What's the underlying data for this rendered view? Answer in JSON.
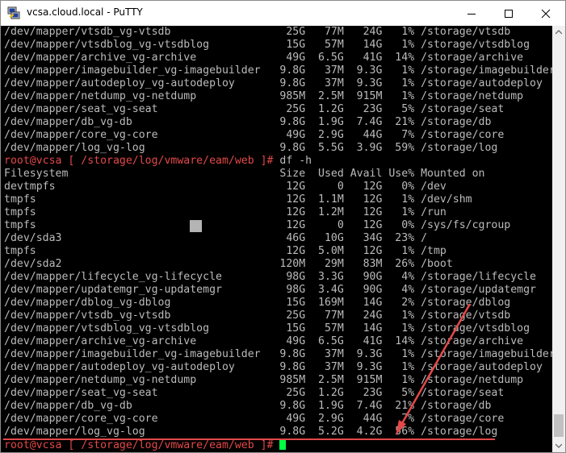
{
  "window": {
    "title": "vcsa.cloud.local - PuTTY",
    "accent_color": "#e44848",
    "cursor_color": "#00ff44"
  },
  "terminal": {
    "lines": [
      "/dev/mapper/vtsdb_vg-vtsdb                  25G   77M   24G   1% /storage/vtsdb",
      "/dev/mapper/vtsdblog_vg-vtsdblog            15G   57M   14G   1% /storage/vtsdblog",
      "/dev/mapper/archive_vg-archive              49G  6.5G   41G  14% /storage/archive",
      "/dev/mapper/imagebuilder_vg-imagebuilder   9.8G   37M  9.3G   1% /storage/imagebuilder",
      "/dev/mapper/autodeploy_vg-autodeploy       9.8G   37M  9.3G   1% /storage/autodeploy",
      "/dev/mapper/netdump_vg-netdump             985M  2.5M  915M   1% /storage/netdump",
      "/dev/mapper/seat_vg-seat                    25G  1.2G   23G   5% /storage/seat",
      "/dev/mapper/db_vg-db                       9.8G  1.9G  7.4G  21% /storage/db",
      "/dev/mapper/core_vg-core                    49G  2.9G   44G   7% /storage/core",
      "/dev/mapper/log_vg-log                     9.8G  5.5G  3.9G  59% /storage/log",
      "",
      "Filesystem                                 Size  Used Avail Use% Mounted on",
      "devtmpfs                                    12G     0   12G   0% /dev",
      "tmpfs                                       12G  1.1M   12G   1% /dev/shm",
      "tmpfs                                       12G  1.2M   12G   1% /run",
      "tmpfs                                       12G     0   12G   0% /sys/fs/cgroup",
      "/dev/sda3                                   46G   10G   34G  23% /",
      "tmpfs                                       12G  5.0M   12G   1% /tmp",
      "/dev/sda2                                  120M   29M   83M  26% /boot",
      "/dev/mapper/lifecycle_vg-lifecycle          98G  3.3G   90G   4% /storage/lifecycle",
      "/dev/mapper/updatemgr_vg-updatemgr          98G  3.4G   90G   4% /storage/updatemgr",
      "/dev/mapper/dblog_vg-dblog                  15G  169M   14G   2% /storage/dblog",
      "/dev/mapper/vtsdb_vg-vtsdb                  25G   77M   24G   1% /storage/vtsdb",
      "/dev/mapper/vtsdblog_vg-vtsdblog            15G   57M   14G   1% /storage/vtsdblog",
      "/dev/mapper/archive_vg-archive              49G  6.5G   41G  14% /storage/archive",
      "/dev/mapper/imagebuilder_vg-imagebuilder   9.8G   37M  9.3G   1% /storage/imagebuilder",
      "/dev/mapper/autodeploy_vg-autodeploy       9.8G   37M  9.3G   1% /storage/autodeploy",
      "/dev/mapper/netdump_vg-netdump             985M  2.5M  915M   1% /storage/netdump",
      "/dev/mapper/seat_vg-seat                    25G  1.2G   23G   5% /storage/seat",
      "/dev/mapper/db_vg-db                       9.8G  1.9G  7.4G  21% /storage/db",
      "/dev/mapper/core_vg-core                    49G  2.9G   44G   7% /storage/core",
      "/dev/mapper/log_vg-log                     9.8G  5.2G  4.2G  56% /storage/log"
    ],
    "prompt1": {
      "prompt": "root@vcsa [ /storage/log/vmware/eam/web ]# ",
      "command": "df -h"
    },
    "prompt2": {
      "prompt": "root@vcsa [ /storage/log/vmware/eam/web ]# "
    }
  }
}
